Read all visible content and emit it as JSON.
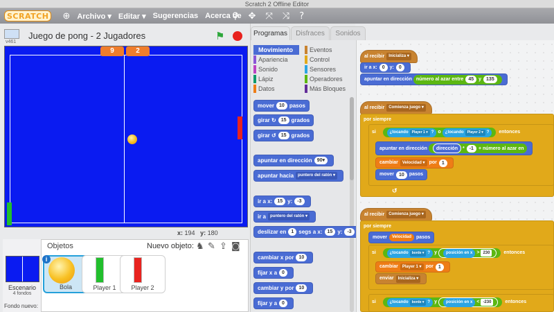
{
  "window": {
    "title": "Scratch 2 Offline Editor"
  },
  "menubar": {
    "logo": "SCRATCH",
    "items": [
      "Archivo ▾",
      "Editar ▾",
      "Sugerencias",
      "Acerca de"
    ],
    "tools": [
      "⚲",
      "✥",
      "⤧",
      "⤨",
      "?"
    ]
  },
  "stage": {
    "version": "v461",
    "project_title": "Juego de pong - 2 Jugadores",
    "score_left": "9",
    "score_right": "2",
    "coord_x_label": "x:",
    "coord_x": "194",
    "coord_y_label": "y:",
    "coord_y": "180"
  },
  "sprites_pane": {
    "stage_label": "Escenario",
    "stage_backdrops": "4 fondos",
    "new_backdrop": "Fondo nuevo:",
    "sprites_label": "Objetos",
    "new_sprite_label": "Nuevo objeto:",
    "sprites": [
      {
        "name": "Bola"
      },
      {
        "name": "Player 1"
      },
      {
        "name": "Player 2"
      }
    ]
  },
  "tabs": [
    "Programas",
    "Disfraces",
    "Sonidos"
  ],
  "categories": [
    {
      "label": "Movimiento",
      "color": "#4a6cd4"
    },
    {
      "label": "Apariencia",
      "color": "#8a55d7"
    },
    {
      "label": "Sonido",
      "color": "#bb42c3"
    },
    {
      "label": "Lápiz",
      "color": "#0e9a6c"
    },
    {
      "label": "Datos",
      "color": "#ee7d16"
    },
    {
      "label": "Eventos",
      "color": "#c88330"
    },
    {
      "label": "Control",
      "color": "#e1a91a"
    },
    {
      "label": "Sensores",
      "color": "#2ca5e2"
    },
    {
      "label": "Operadores",
      "color": "#5cb712"
    },
    {
      "label": "Más Bloques",
      "color": "#632d99"
    }
  ],
  "palette": {
    "move": {
      "a": "mover",
      "v": "10",
      "b": "pasos"
    },
    "turn_right": {
      "a": "girar",
      "icon": "↻",
      "v": "15",
      "b": "grados"
    },
    "turn_left": {
      "a": "girar",
      "icon": "↺",
      "v": "15",
      "b": "grados"
    },
    "point_dir": {
      "a": "apuntar en dirección",
      "v": "90▾"
    },
    "point_towards": {
      "a": "apuntar hacia",
      "v": "puntero del ratón ▾"
    },
    "goto_xy": {
      "a": "ir a x:",
      "x": "15",
      "b": "y:",
      "y": "-3"
    },
    "goto": {
      "a": "ir a",
      "v": "puntero del ratón ▾"
    },
    "glide": {
      "a": "deslizar en",
      "s": "1",
      "b": "segs a x:",
      "x": "15",
      "c": "y:",
      "y": "-3"
    },
    "change_x": {
      "a": "cambiar x por",
      "v": "10"
    },
    "set_x": {
      "a": "fijar x a",
      "v": "0"
    },
    "change_y": {
      "a": "cambiar y por",
      "v": "10"
    },
    "set_y": {
      "a": "fijar y a",
      "v": "0"
    }
  },
  "scripts": {
    "s1_hat": {
      "a": "al recibir",
      "msg": "Inicializa ▾"
    },
    "s1_goto": {
      "a": "ir a x:",
      "x": "0",
      "b": "y:",
      "y": "0"
    },
    "s1_point": {
      "a": "apuntar en dirección",
      "op": "número al azar entre",
      "lo": "45",
      "y": "y",
      "hi": "135"
    },
    "s2_hat": {
      "a": "al recibir",
      "msg": "Comienza juego ▾"
    },
    "s2_forever": "por siempre",
    "s2_if": {
      "a": "si",
      "t1": "¿tocando",
      "o1": "Player 1 ▾",
      "q1": "?",
      "or": "o",
      "t2": "¿tocando",
      "o2": "Player 2 ▾",
      "q2": "?",
      "then": "entonces"
    },
    "s2_point": {
      "a": "apuntar en dirección",
      "dir": "dirección",
      "mul": "*",
      "n": "-1",
      "plus": "+",
      "rnd": "número al azar en"
    },
    "s2_change": {
      "a": "cambiar",
      "var": "Velocidad ▾",
      "b": "por",
      "v": "1"
    },
    "s2_move": {
      "a": "mover",
      "v": "10",
      "b": "pasos"
    },
    "s3_hat": {
      "a": "al recibir",
      "msg": "Comienza juego ▾"
    },
    "s3_forever": "por siempre",
    "s3_move": {
      "a": "mover",
      "var": "Velocidad",
      "b": "pasos"
    },
    "s3_if1": {
      "a": "si",
      "t": "¿tocando",
      "o": "borde ▾",
      "q": "?",
      "y": "y",
      "pos": "posición en x",
      "cmp": ">",
      "v": "230",
      "then": "entonces"
    },
    "s3_change": {
      "a": "cambiar",
      "var": "Player 1 ▾",
      "b": "por",
      "v": "1"
    },
    "s3_send": {
      "a": "enviar",
      "msg": "Inicializa ▾"
    },
    "s3_if2": {
      "a": "si",
      "t": "¿tocando",
      "o": "borde ▾",
      "q": "?",
      "y": "y",
      "pos": "posición en x",
      "cmp": "<",
      "v": "-230",
      "then": "entonces"
    }
  }
}
